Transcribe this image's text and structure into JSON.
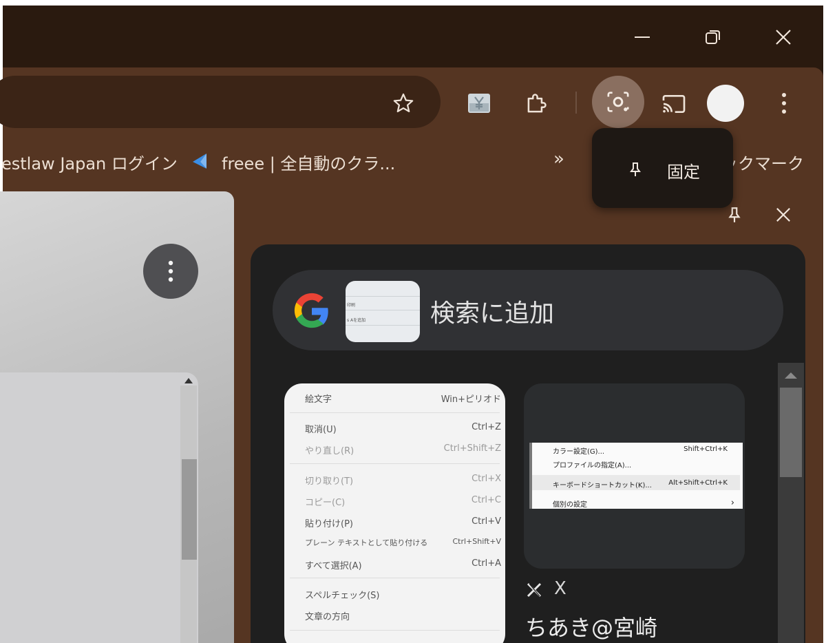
{
  "window_controls": {
    "minimize": "minimize-icon",
    "restore": "restore-icon",
    "close": "close-icon"
  },
  "toolbar": {
    "icons": [
      "star-icon",
      "yen-extension-icon",
      "extensions-puzzle-icon",
      "lens-icon",
      "cast-icon",
      "profile-avatar",
      "more-vert-icon"
    ]
  },
  "bookmarks": {
    "items": [
      {
        "label": "estlaw Japan ログイン"
      },
      {
        "label": "freee | 全自動のクラ..."
      }
    ],
    "overflow": "»",
    "other_label": "ックマーク"
  },
  "tooltip": {
    "label": "固定"
  },
  "lens": {
    "search_label": "検索に追加",
    "thumb_lines": [
      "印刷",
      "s Aを追加"
    ],
    "card1_rows": [
      {
        "k": "絵文字",
        "s": "Win+ピリオド",
        "dim": false
      },
      {
        "k": "取消(U)",
        "s": "Ctrl+Z",
        "dim": false
      },
      {
        "k": "やり直し(R)",
        "s": "Ctrl+Shift+Z",
        "dim": true
      },
      {
        "k": "切り取り(T)",
        "s": "Ctrl+X",
        "dim": true
      },
      {
        "k": "コピー(C)",
        "s": "Ctrl+C",
        "dim": true
      },
      {
        "k": "貼り付け(P)",
        "s": "Ctrl+V",
        "dim": false
      },
      {
        "k": "プレーン テキストとして貼り付ける",
        "s": "Ctrl+Shift+V",
        "dim": false
      },
      {
        "k": "すべて選択(A)",
        "s": "Ctrl+A",
        "dim": false
      },
      {
        "k": "スペルチェック(S)",
        "s": "",
        "dim": false
      },
      {
        "k": "文章の方向",
        "s": "",
        "dim": false
      }
    ],
    "card2_rows": [
      {
        "k": "カラー設定(G)...",
        "s": "Shift+Ctrl+K"
      },
      {
        "k": "プロファイルの指定(A)...",
        "s": ""
      },
      {
        "k": "キーボードショートカット(K)...",
        "s": "Alt+Shift+Ctrl+K"
      },
      {
        "k": "個別の設定",
        "s": "›"
      }
    ],
    "card2_source": "X",
    "card2_title": "ちあき@宮崎"
  }
}
